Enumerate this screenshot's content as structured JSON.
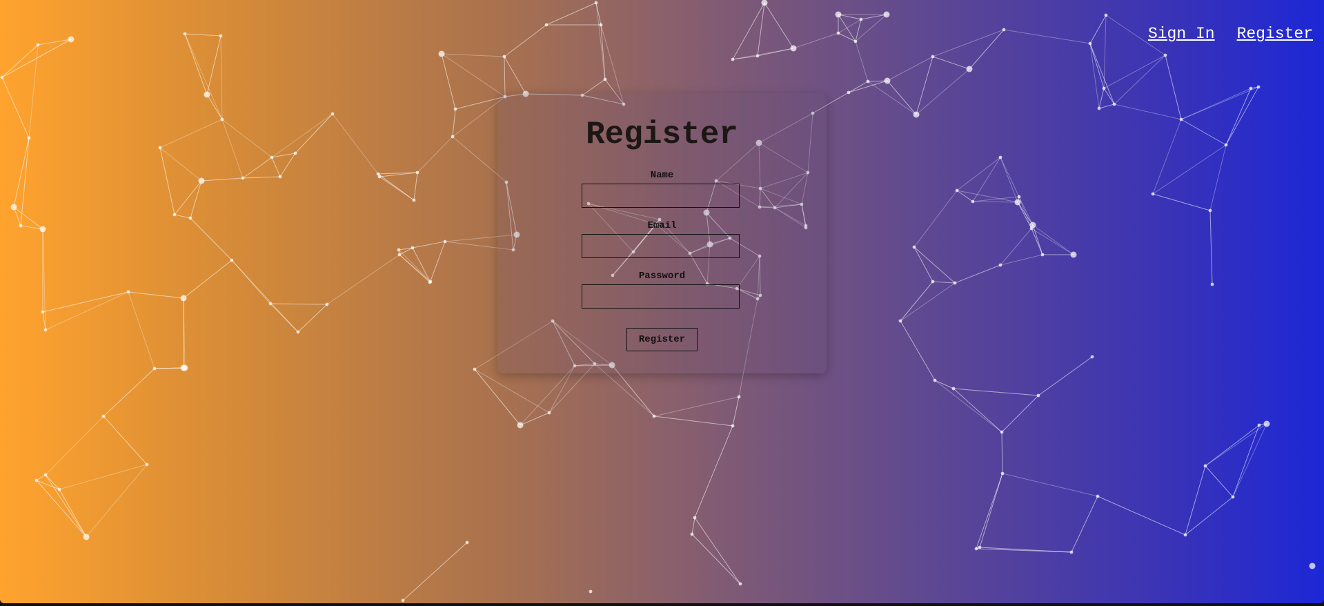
{
  "nav": {
    "sign_in": "Sign In",
    "register": "Register"
  },
  "form": {
    "title": "Register",
    "name_label": "Name",
    "name_value": "",
    "email_label": "Email",
    "email_value": "",
    "password_label": "Password",
    "password_value": "",
    "submit_label": "Register"
  },
  "colors": {
    "gradient_start": "#ffa32e",
    "gradient_end": "#1c27d6",
    "particle": "#ffffff"
  }
}
